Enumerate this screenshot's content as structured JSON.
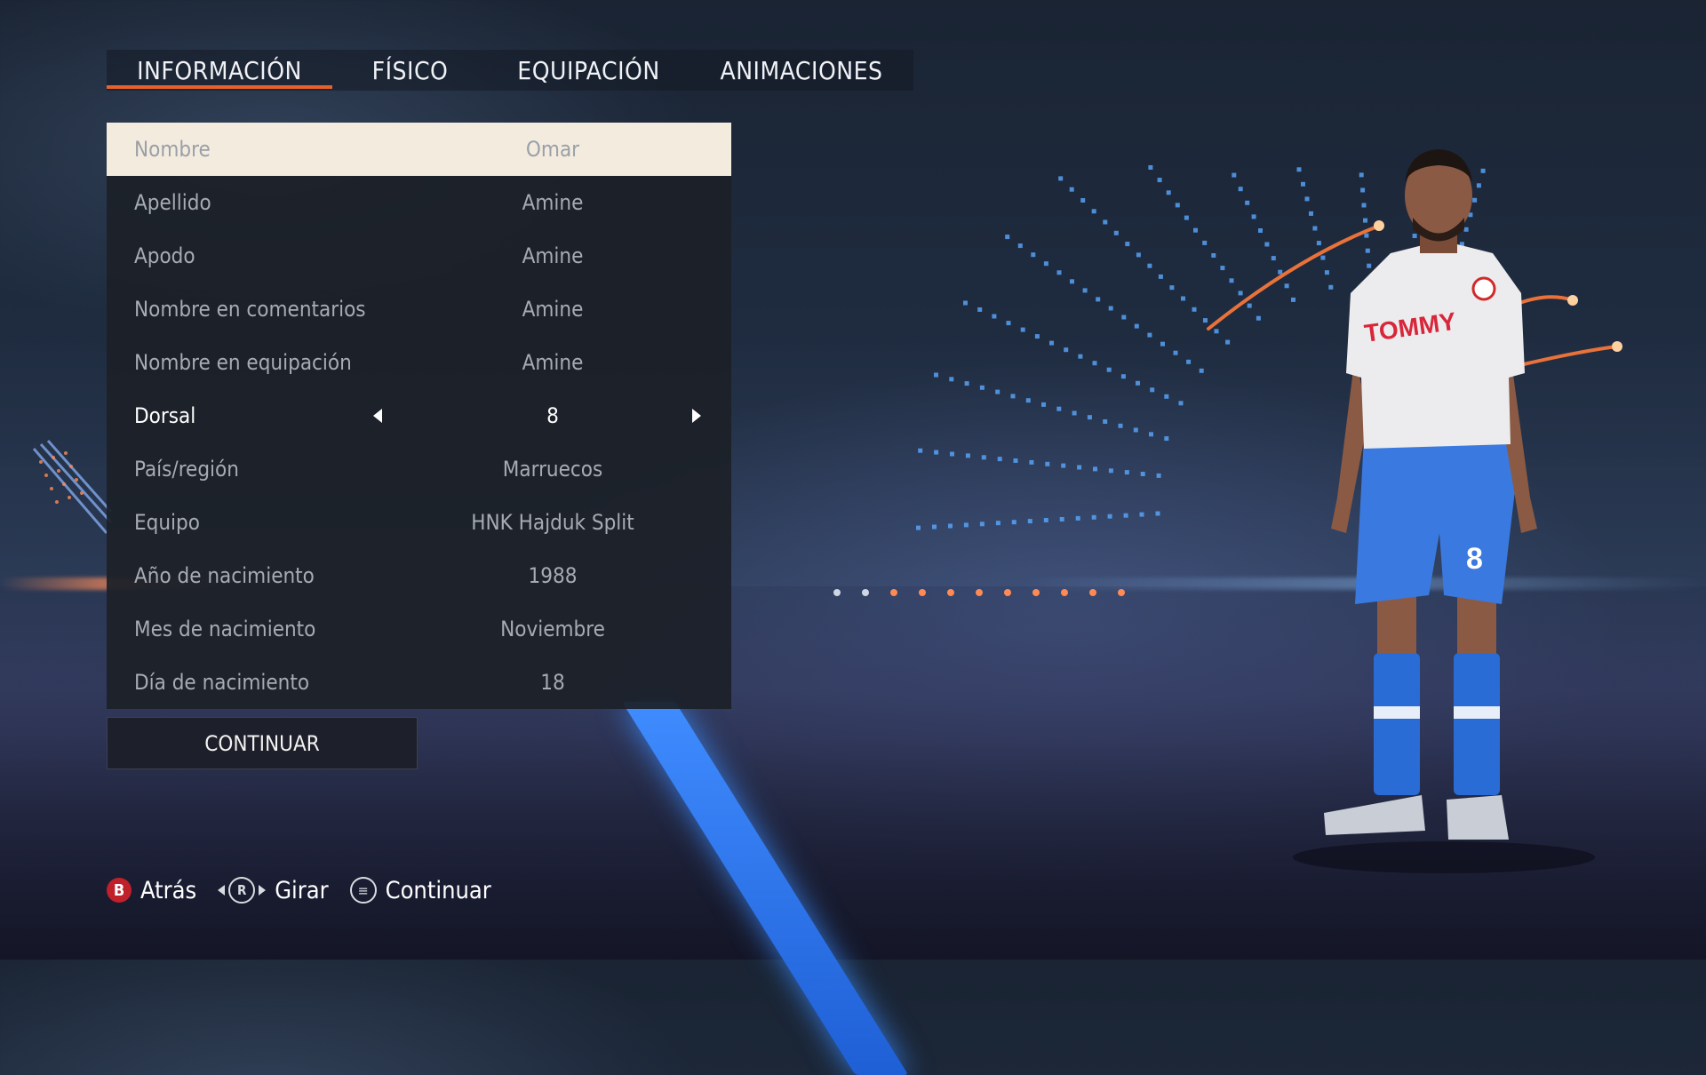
{
  "tabs": [
    {
      "label": "INFORMACIÓN",
      "active": true
    },
    {
      "label": "FÍSICO",
      "active": false
    },
    {
      "label": "EQUIPACIÓN",
      "active": false
    },
    {
      "label": "ANIMACIONES",
      "active": false
    }
  ],
  "form": {
    "rows": [
      {
        "label": "Nombre",
        "value": "Omar"
      },
      {
        "label": "Apellido",
        "value": "Amine"
      },
      {
        "label": "Apodo",
        "value": "Amine"
      },
      {
        "label": "Nombre en comentarios",
        "value": "Amine"
      },
      {
        "label": "Nombre en equipación",
        "value": "Amine"
      },
      {
        "label": "Dorsal",
        "value": "8"
      },
      {
        "label": "País/región",
        "value": "Marruecos"
      },
      {
        "label": "Equipo",
        "value": "HNK Hajduk Split"
      },
      {
        "label": "Año de nacimiento",
        "value": "1988"
      },
      {
        "label": "Mes de nacimiento",
        "value": "Noviembre"
      },
      {
        "label": "Día de nacimiento",
        "value": "18"
      }
    ]
  },
  "continue_label": "CONTINUAR",
  "hints": {
    "back_button_glyph": "B",
    "back_label": "Atrás",
    "rotate_button_glyph": "R",
    "rotate_label": "Girar",
    "continue_label": "Continuar"
  },
  "player": {
    "shirt_sponsor": "TOMMY",
    "shorts_number": "8"
  },
  "colors": {
    "accent": "#e8612c",
    "selected_row": "#f3ebde",
    "panel": "#1c2028",
    "back_button": "#c0202a"
  }
}
